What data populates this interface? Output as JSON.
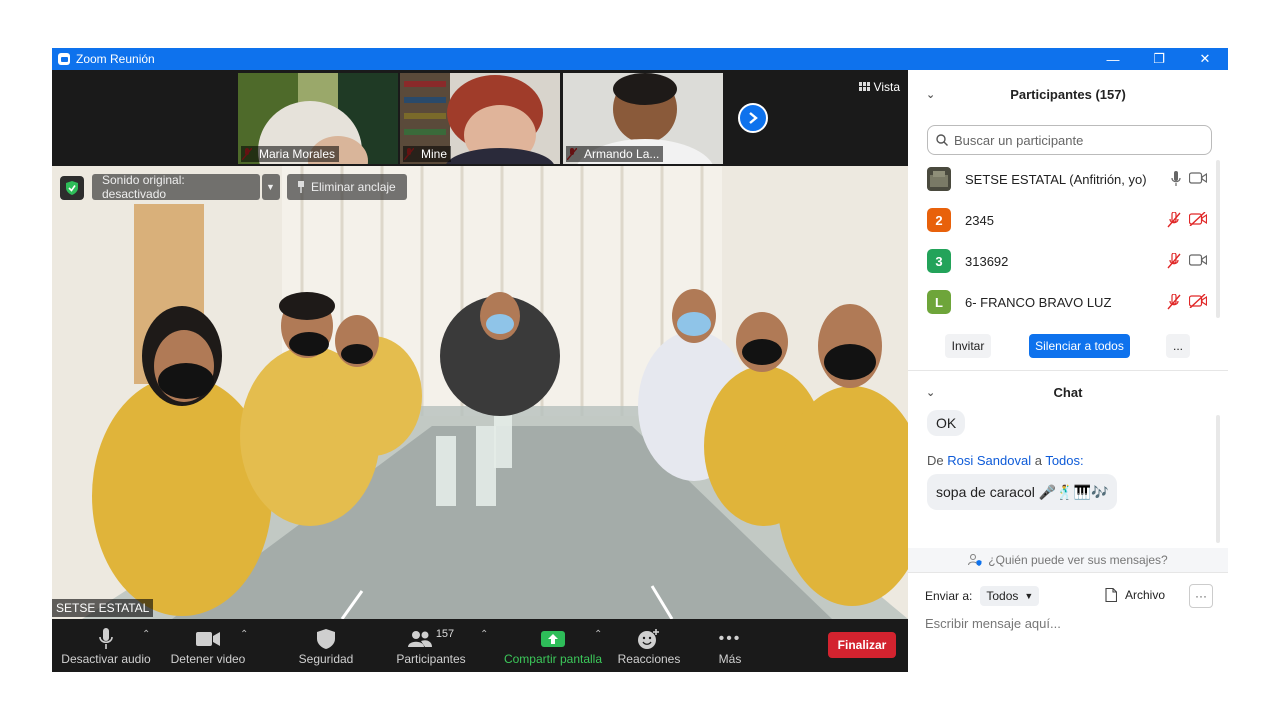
{
  "window": {
    "title": "Zoom Reunión"
  },
  "strip": {
    "thumbs": [
      {
        "name": "Maria Morales"
      },
      {
        "name": "Mine"
      },
      {
        "name": "Armando La..."
      }
    ],
    "view_label": "Vista"
  },
  "main_video": {
    "sound_label": "Sonido original: desactivado",
    "unpin_label": "Eliminar anclaje",
    "speaker_name": "SETSE ESTATAL"
  },
  "toolbar": {
    "mute_label": "Desactivar audio",
    "video_label": "Detener video",
    "security_label": "Seguridad",
    "participants_label": "Participantes",
    "participants_count": "157",
    "share_label": "Compartir pantalla",
    "reactions_label": "Reacciones",
    "more_label": "Más",
    "end_label": "Finalizar"
  },
  "participants": {
    "title": "Participantes (157)",
    "search_placeholder": "Buscar un participante",
    "items": [
      {
        "initial": "",
        "name": "SETSE ESTATAL (Anfitrión, yo)",
        "color": "#5a5a4a"
      },
      {
        "initial": "2",
        "name": "2345",
        "color": "#e8610b"
      },
      {
        "initial": "3",
        "name": "313692",
        "color": "#23a35a"
      },
      {
        "initial": "L",
        "name": "6- FRANCO BRAVO LUZ",
        "color": "#6ea53a"
      }
    ],
    "invite_label": "Invitar",
    "mute_all_label": "Silenciar a todos",
    "more_label": "..."
  },
  "chat": {
    "title": "Chat",
    "prev_message": "OK",
    "from_prefix": "De",
    "from_name": "Rosi Sandoval",
    "from_connector": "a",
    "from_target": "Todos:",
    "message": "sopa de caracol 🎤🕺🎹🎶",
    "who_sees": "¿Quién puede ver sus mensajes?",
    "send_to_label": "Enviar a:",
    "send_to_value": "Todos",
    "file_label": "Archivo",
    "more_label": "···",
    "input_placeholder": "Escribir mensaje aquí..."
  }
}
